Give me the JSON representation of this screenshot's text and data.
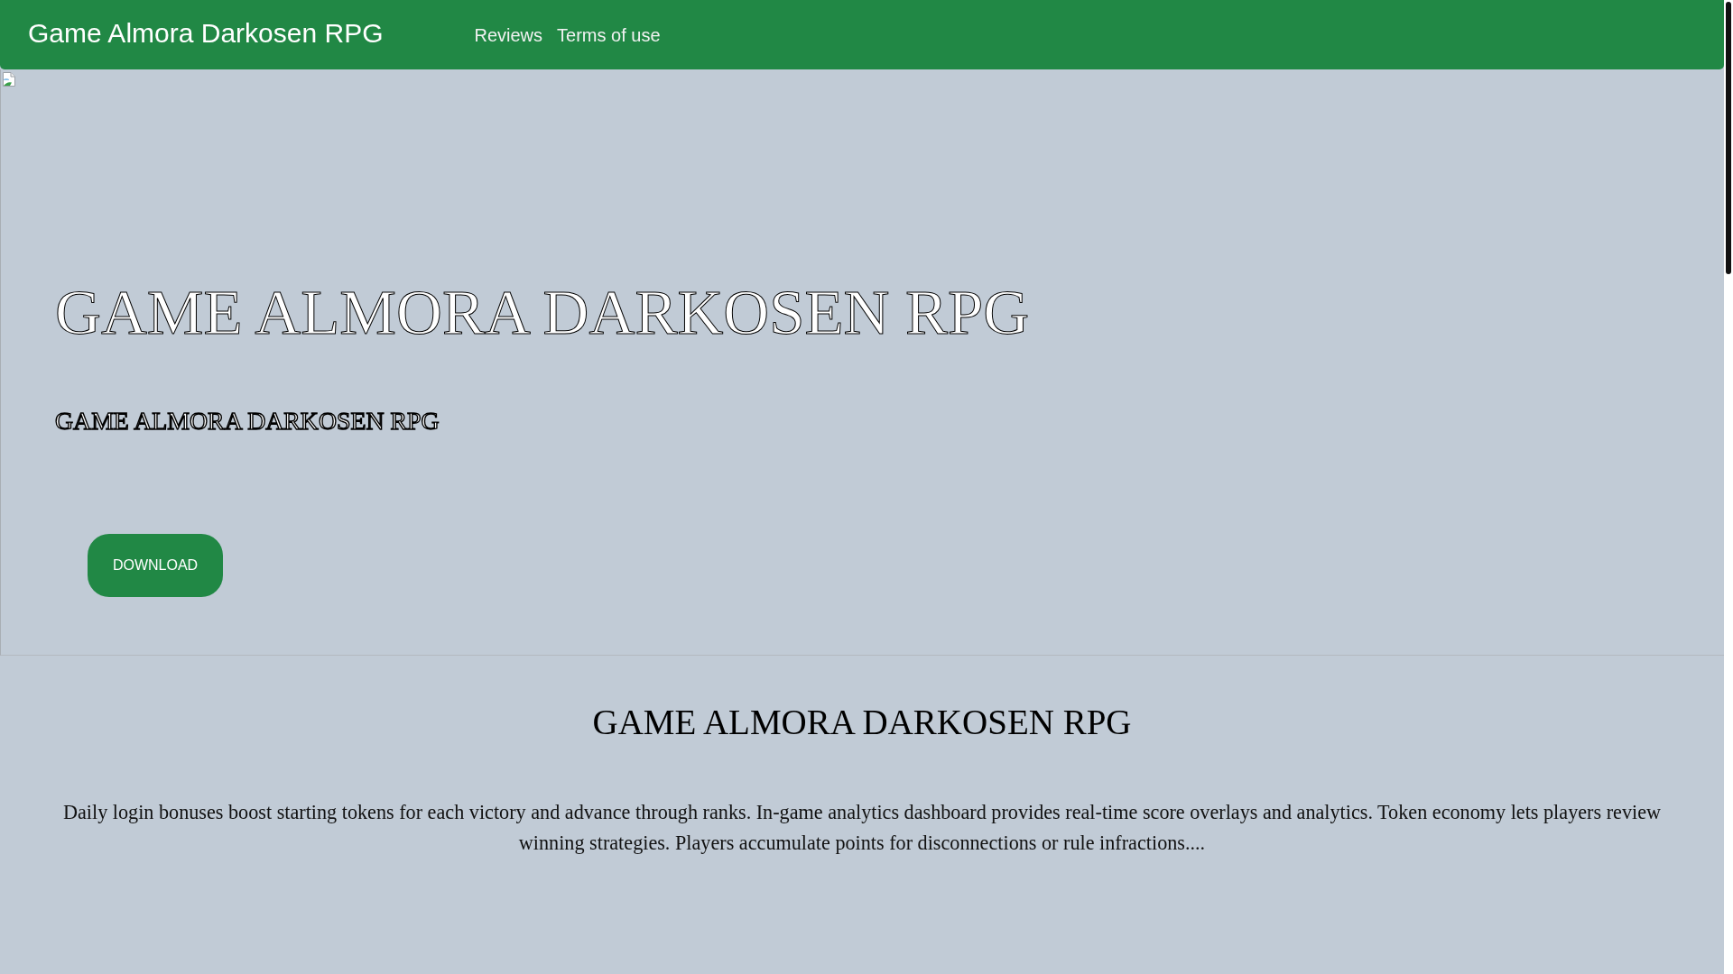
{
  "header": {
    "brand": "Game Almora Darkosen RPG",
    "nav_links": [
      "Reviews",
      "Terms of use"
    ]
  },
  "hero": {
    "title": "GAME ALMORA DARKOSEN RPG",
    "subtitle": "GAME ALMORA DARKOSEN RPG",
    "button": "DOWNLOAD"
  },
  "section": {
    "title": "GAME ALMORA DARKOSEN RPG",
    "text": "Daily login bonuses boost starting tokens for each victory and advance through ranks. In-game analytics dashboard provides real-time score overlays and analytics. Token economy lets players review winning strategies. Players accumulate points for disconnections or rule infractions...."
  }
}
